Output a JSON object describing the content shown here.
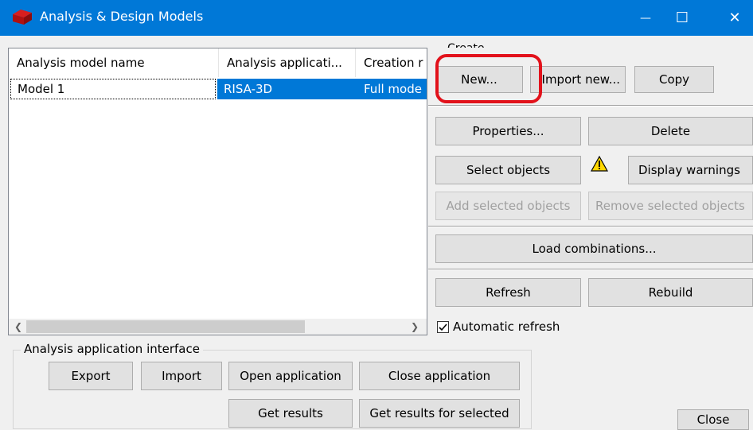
{
  "window": {
    "title": "Analysis & Design Models",
    "minimize": "—",
    "maximize": "☐",
    "close": "✕"
  },
  "list": {
    "columns": [
      "Analysis model name",
      "Analysis applicati...",
      "Creation r"
    ],
    "rows": [
      {
        "name": "Model 1",
        "application": "RISA-3D",
        "creation": "Full mode"
      }
    ]
  },
  "create": {
    "group_label": "Create",
    "new": "New...",
    "import_new": "Import new...",
    "copy": "Copy"
  },
  "actions": {
    "properties": "Properties...",
    "delete": "Delete",
    "select_objects": "Select objects",
    "display_warnings": "Display warnings",
    "add_selected": "Add selected objects",
    "remove_selected": "Remove selected objects",
    "load_combinations": "Load combinations...",
    "refresh": "Refresh",
    "rebuild": "Rebuild",
    "automatic_refresh": "Automatic refresh",
    "automatic_refresh_checked": true
  },
  "interface": {
    "group_label": "Analysis application interface",
    "export": "Export",
    "import": "Import",
    "open_application": "Open application",
    "close_application": "Close application",
    "get_results": "Get results",
    "get_results_selected": "Get results for selected"
  },
  "dialog": {
    "close": "Close"
  },
  "colors": {
    "titlebar": "#0078d7",
    "selection": "#0078d7",
    "highlight_annotation": "#e2121b",
    "warning": "#ffd700"
  }
}
